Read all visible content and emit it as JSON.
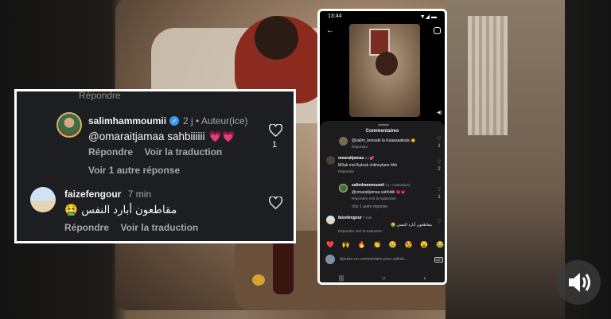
{
  "zoom_card": {
    "faded_top": "Répondre",
    "comment1": {
      "username": "salimhammoumii",
      "meta": "2 j • Auteur(ice)",
      "text": "@omaraitjamaa sahbiiiiii",
      "emoji": "💗💗",
      "reply": "Répondre",
      "translate": "Voir la traduction",
      "likes": "1"
    },
    "see_more": "Voir 1 autre réponse",
    "comment2": {
      "username": "faizefengour",
      "meta": "7 min",
      "emoji": "🤮",
      "text": "مقاطعون أبارد النفس",
      "reply": "Répondre",
      "translate": "Voir la traduction"
    }
  },
  "phone": {
    "time": "13:44",
    "status_right": "▼◢ ▬",
    "comments_title": "Commentaires",
    "c0": {
      "text": "@salim_kessabi la Kaaaaaabala 👏",
      "reply": "Répondre",
      "likes": "1"
    },
    "c1": {
      "username": "omaraitjamaa",
      "meta": "2 j 💕",
      "text": "M3ak mol lkylosk chkhsylann hhh",
      "reply": "Répondre",
      "likes": "2"
    },
    "c2": {
      "username": "salimhammoumii",
      "meta": "2 j • Auteur(ice)",
      "text": "@omaraitjamaa sahbiiiiii 💗💗",
      "reply": "Répondre",
      "translate": "Voir la traduction",
      "likes": "1"
    },
    "see_more": "Voir 1 autre réponse",
    "c3": {
      "username": "faizefengour",
      "meta": "7 min",
      "text": "مقاطعون أبارد النفس 🤮",
      "reply": "Répondre",
      "translate": "Voir la traduction"
    },
    "emojis": [
      "❤️",
      "🙌",
      "🔥",
      "👏",
      "😢",
      "😍",
      "😮",
      "😂"
    ],
    "input_placeholder": "Ajoutez un commentaire pour salimh...",
    "gif": "GIF"
  },
  "colors": {
    "verified": "#3897f0",
    "card_bg": "#1d1e21",
    "phone_bg": "#1c1c1e"
  }
}
